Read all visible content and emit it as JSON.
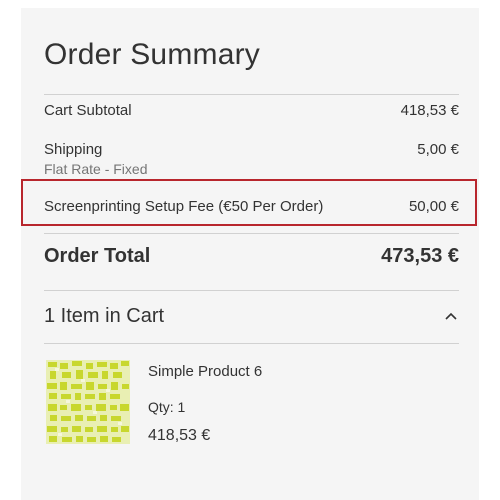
{
  "summary": {
    "title": "Order Summary",
    "subtotal": {
      "label": "Cart Subtotal",
      "value": "418,53 €"
    },
    "shipping": {
      "label": "Shipping",
      "method": "Flat Rate - Fixed",
      "value": "5,00 €"
    },
    "fee": {
      "label": "Screenprinting Setup Fee (€50 Per Order)",
      "value": "50,00 €"
    },
    "total": {
      "label": "Order Total",
      "value": "473,53 €"
    }
  },
  "cart": {
    "items_label": "1 Item in Cart",
    "expanded": true,
    "items": [
      {
        "name": "Simple Product 6",
        "qty": "Qty: 1",
        "price": "418,53 €",
        "thumbnail_icon": "product-thumbnail"
      }
    ]
  },
  "colors": {
    "panel_bg": "#f5f5f5",
    "highlight_border": "#b8262d",
    "thumbnail_green": "#c8d72e"
  }
}
